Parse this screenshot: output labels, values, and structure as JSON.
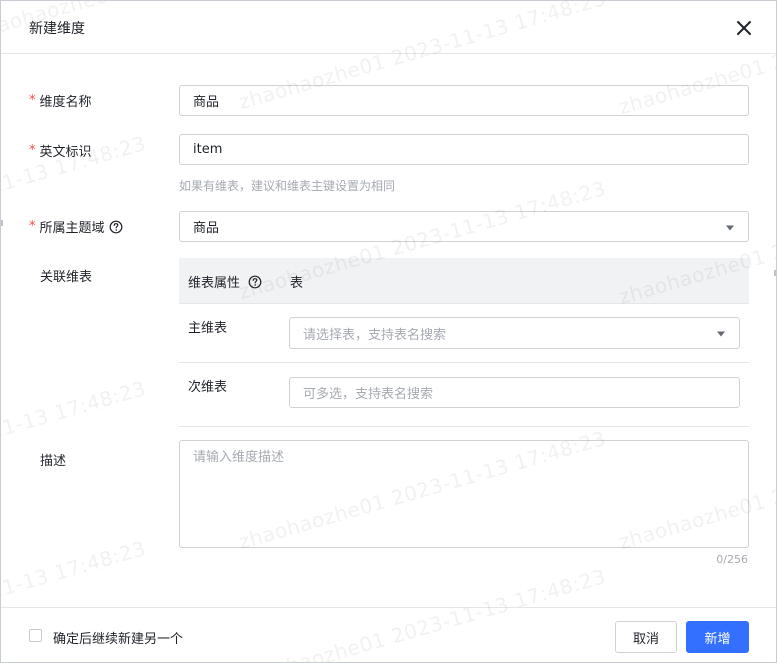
{
  "dialog": {
    "title": "新建维度"
  },
  "form": {
    "name": {
      "label": "维度名称",
      "value": "商品"
    },
    "english_id": {
      "label": "英文标识",
      "value": "item",
      "hint": "如果有维表，建议和维表主键设置为相同"
    },
    "domain": {
      "label": "所属主题域",
      "value": "商品"
    },
    "linked_tables": {
      "label": "关联维表",
      "columns": [
        "维表属性",
        "表"
      ],
      "rows": [
        {
          "label": "主维表",
          "placeholder": "请选择表，支持表名搜索"
        },
        {
          "label": "次维表",
          "placeholder": "可多选，支持表名搜索"
        }
      ]
    },
    "description": {
      "label": "描述",
      "placeholder": "请输入维度描述",
      "counter": "0/256"
    }
  },
  "footer": {
    "continue_label": "确定后继续新建另一个",
    "cancel_label": "取消",
    "submit_label": "新增"
  },
  "watermark": {
    "text": "zhaohaozhe01 2023-11-13 17:48:23"
  },
  "colors": {
    "primary": "#3370ff",
    "required": "#f54a45",
    "placeholder": "#a6abb2",
    "border": "#d0d3d6",
    "table_header_bg": "#f1f2f4"
  },
  "icons": {
    "close": "close-icon",
    "help": "question-circle-icon",
    "dropdown": "caret-down-icon"
  }
}
